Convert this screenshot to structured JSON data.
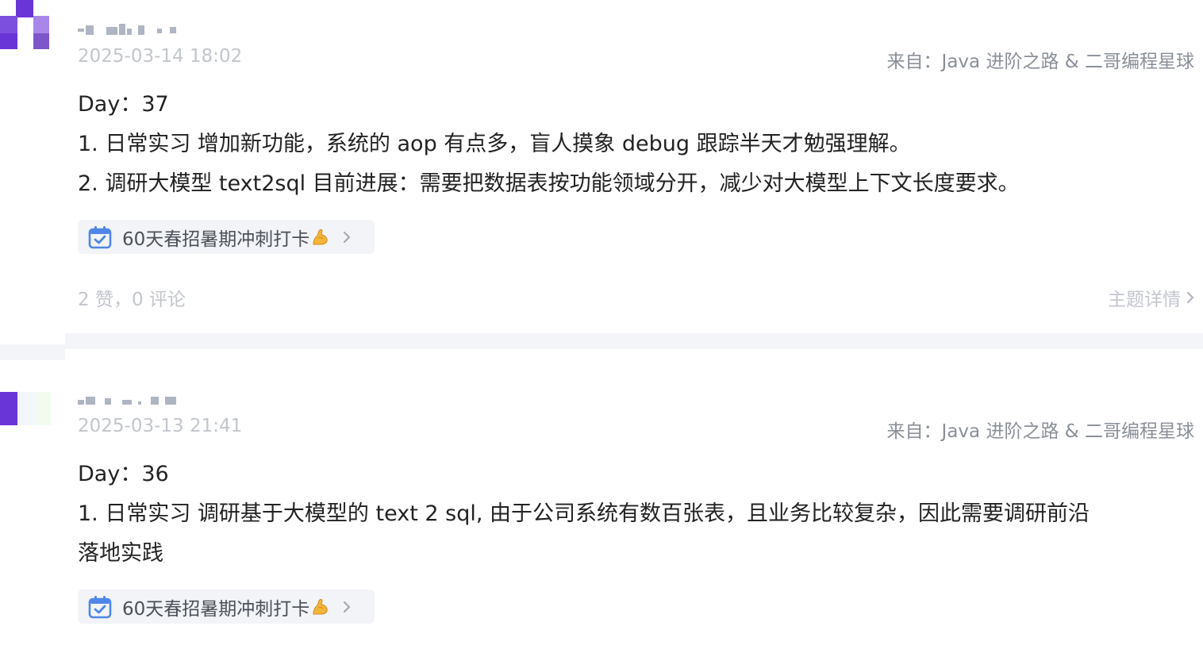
{
  "posts": [
    {
      "author_name": "",
      "timestamp": "2025-03-14 18:02",
      "source": "来自：Java 进阶之路 & 二哥编程星球",
      "content_lines": [
        "Day：37",
        "1. 日常实习  增加新功能，系统的 aop 有点多，盲人摸象 debug 跟踪半天才勉强理解。",
        "2. 调研大模型 text2sql  目前进展：需要把数据表按功能领域分开，减少对大模型上下文长度要求。"
      ],
      "topic_chip": {
        "label": "60天春招暑期冲刺打卡",
        "icon": "calendar-check-icon",
        "emoji": "flexed-biceps-icon"
      },
      "stats": "2 赞，0 评论",
      "detail_link": "主题详情"
    },
    {
      "author_name": "",
      "timestamp": "2025-03-13 21:41",
      "source": "来自：Java 进阶之路 & 二哥编程星球",
      "content_lines": [
        "Day：36",
        "1. 日常实习  调研基于大模型的 text 2 sql, 由于公司系统有数百张表，且业务比较复杂，因此需要调研前沿",
        "落地实践"
      ],
      "topic_chip": {
        "label": "60天春招暑期冲刺打卡",
        "icon": "calendar-check-icon",
        "emoji": "flexed-biceps-icon"
      }
    }
  ],
  "colors": {
    "avatar_purple": "#6a35d6",
    "avatar_lilac": "#a987e8",
    "chip_icon_blue": "#4f86e8",
    "muted_text": "#c2c6cd",
    "divider": "#f3f5f8"
  }
}
